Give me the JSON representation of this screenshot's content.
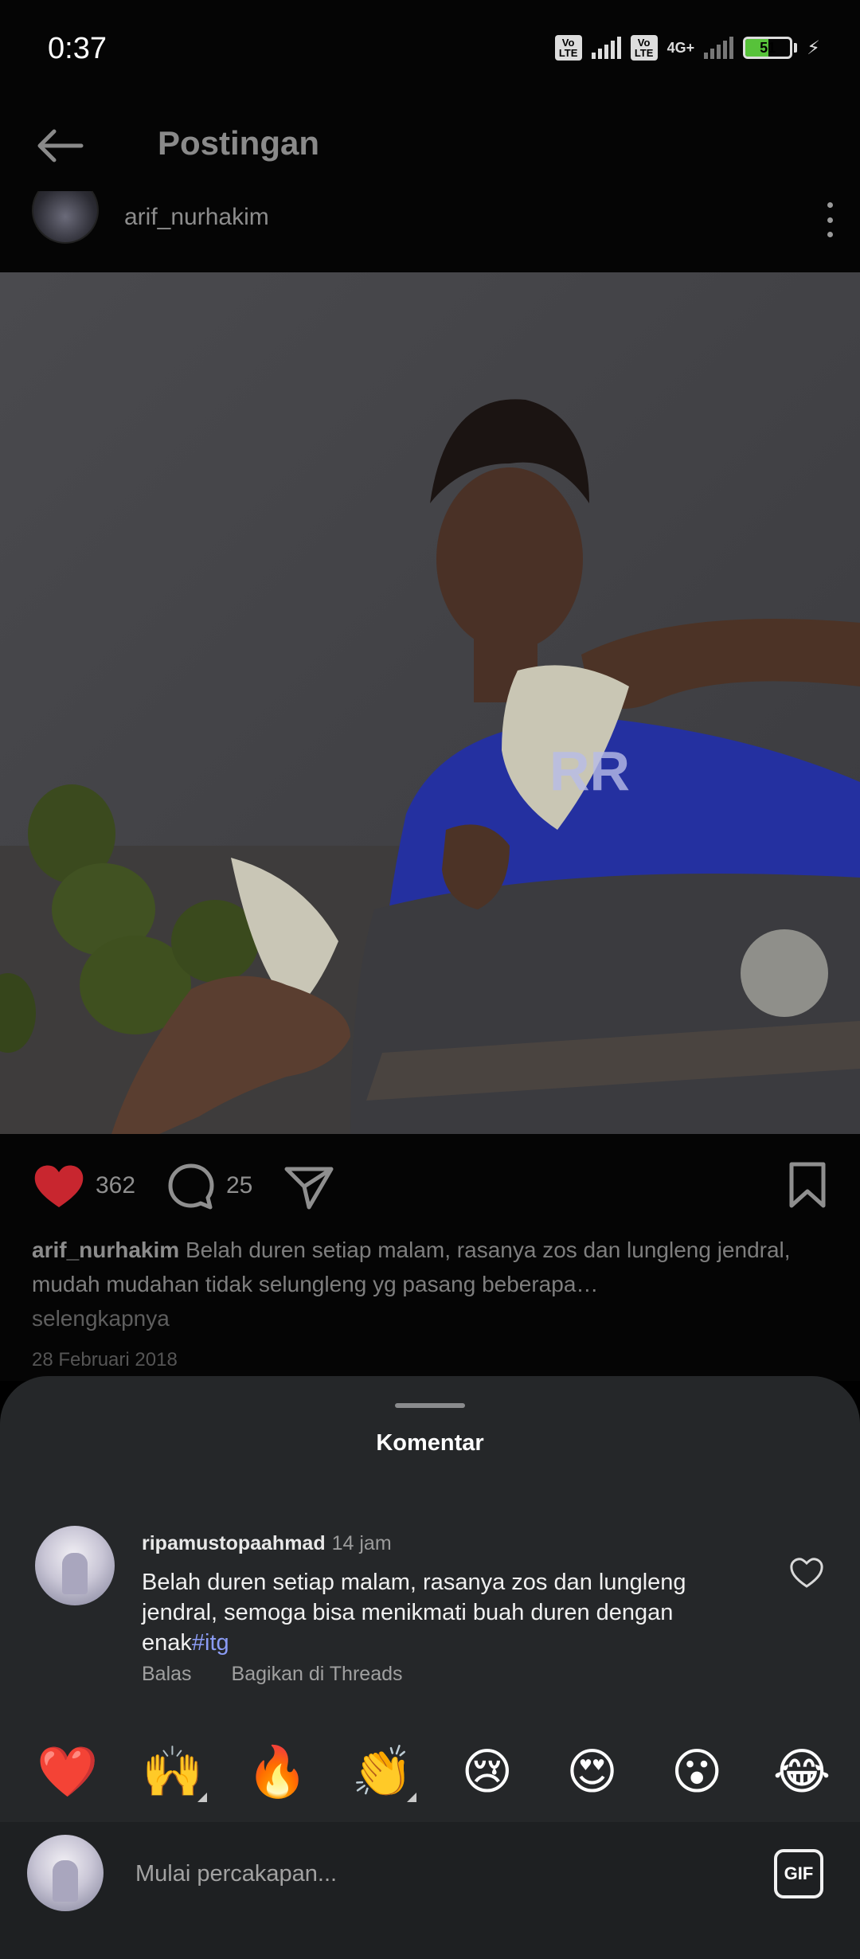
{
  "status_bar": {
    "time": "0:37",
    "volte1": "Vo LTE",
    "volte2": "Vo LTE",
    "network": "4G+",
    "battery": "51",
    "battery_level": 0.51
  },
  "header": {
    "title": "Postingan"
  },
  "post": {
    "username": "arif_nurhakim",
    "like_count": "362",
    "comment_count": "25",
    "caption_user": "arif_nurhakim",
    "caption_text": "Belah duren setiap malam,  rasanya zos dan lungleng jendral,  mudah mudahan tidak selungleng yg pasang beberapa…",
    "caption_more": "selengkapnya",
    "date": "28 Februari 2018"
  },
  "comments_sheet": {
    "title": "Komentar",
    "comment": {
      "username": "ripamustopaahmad",
      "time": "14 jam",
      "text": "Belah duren setiap malam, rasanya zos dan lungleng jendral, semoga bisa menikmati buah duren dengan enak",
      "hashtag": "#itg",
      "reply": "Balas",
      "share_threads": "Bagikan di Threads"
    },
    "emojis": [
      "❤️",
      "🙌",
      "🔥",
      "👏",
      "😢",
      "😍",
      "😮",
      "😂"
    ],
    "composer": {
      "placeholder": "Mulai percakapan...",
      "gif_label": "GIF"
    }
  },
  "colors": {
    "like_red": "#d42c3a",
    "hashtag": "#8b9cf5",
    "sheet_bg": "#252729",
    "battery_green": "#57c23a"
  }
}
